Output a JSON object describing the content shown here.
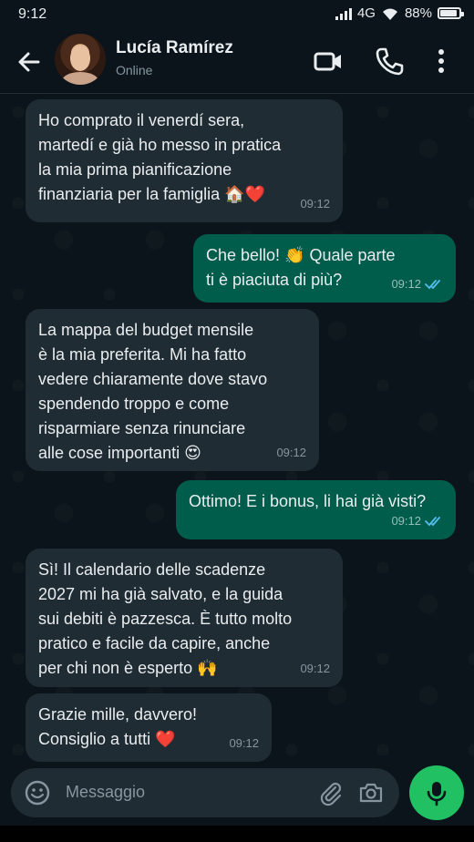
{
  "status_bar": {
    "time": "9:12",
    "network": "4G",
    "battery": "88%"
  },
  "header": {
    "contact_name": "Lucía Ramírez",
    "status": "Online"
  },
  "messages": [
    {
      "direction": "in",
      "text": "Ho comprato il venerdí sera,\nmartedí e già ho messo in pratica\nla mia prima pianificazione\nfinanziaria per la famiglia 🏠❤️",
      "time": "09:12"
    },
    {
      "direction": "out",
      "text": "Che bello! 👏 Quale parte\nti è piaciuta di più?",
      "time": "09:12"
    },
    {
      "direction": "in",
      "text": "La mappa del budget mensile\nè la mia preferita.  Mi ha fatto\nvedere chiaramente dove stavo\nspendendo troppo e come\nrisparmiare senza rinunciare\nalle cose importanti 😍",
      "time": "09:12"
    },
    {
      "direction": "out",
      "text": "Ottimo! E i bonus, li hai già visti?",
      "time": "09:12"
    },
    {
      "direction": "in",
      "text": "Sì! Il calendario delle scadenze\n2027 mi ha già salvato, e la guida\nsui debiti è pazzesca. È tutto molto\npratico e facile da capire, anche\nper chi non è esperto 🙌",
      "time": "09:12"
    },
    {
      "direction": "in",
      "text": "Grazie mille, davvero!\nConsiglio a tutti ❤️",
      "time": "09:12"
    }
  ],
  "input": {
    "placeholder": "Messaggio"
  },
  "icons": [
    "back-arrow-icon",
    "video-call-icon",
    "phone-icon",
    "more-options-icon",
    "emoji-icon",
    "attach-icon",
    "camera-icon",
    "mic-icon",
    "read-receipt-icon"
  ],
  "colors": {
    "incoming_bubble": "#202c33",
    "outgoing_bubble": "#005c4b",
    "accent": "#21c063",
    "read_tick": "#53bdeb"
  }
}
